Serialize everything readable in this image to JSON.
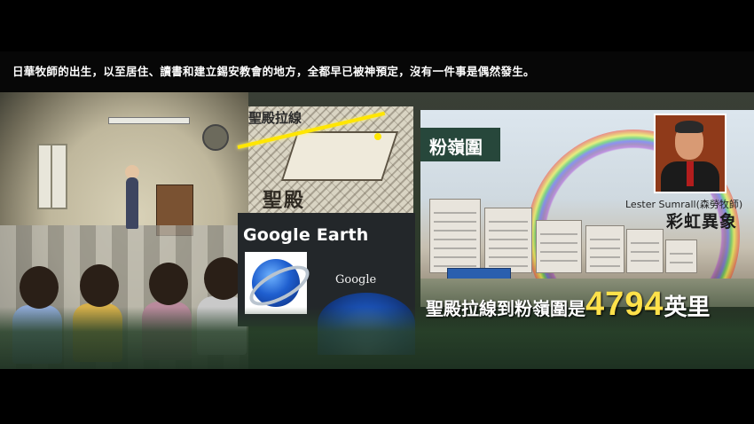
{
  "caption": "日華牧師的出生，以至居住、讀書和建立錫安教會的地方，全都早已被神預定，沒有一件事是偶然發生。",
  "temple": {
    "title": "聖殿拉線",
    "label": "聖殿"
  },
  "google_earth": {
    "title": "Google Earth",
    "logo_icon": "google-earth-logo-icon",
    "google_word": "Google"
  },
  "fanling": {
    "tag": "粉嶺圍"
  },
  "portrait": {
    "name": "Lester Sumrall(森勞牧師)",
    "label": "彩虹異象"
  },
  "distance": {
    "prefix": "聖殿拉線到粉嶺圍是",
    "number": "4794",
    "unit": "英里"
  },
  "colors": {
    "highlight": "#ffe14a",
    "line": "#ffe600",
    "tag_bg": "#27473b"
  }
}
